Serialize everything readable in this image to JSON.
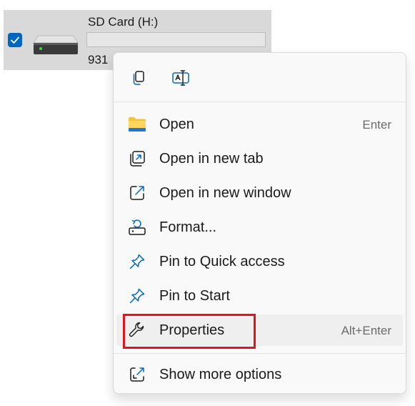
{
  "drive": {
    "name": "SD Card (H:)",
    "size_text": "931",
    "usage_fraction": 0.0,
    "selected": true
  },
  "quick_actions": [
    {
      "icon": "copy-icon"
    },
    {
      "icon": "rename-icon"
    }
  ],
  "menu": {
    "items": [
      {
        "label": "Open",
        "accelerator": "Enter",
        "icon": "folder-icon"
      },
      {
        "label": "Open in new tab",
        "accelerator": "",
        "icon": "new-tab-icon"
      },
      {
        "label": "Open in new window",
        "accelerator": "",
        "icon": "new-window-icon"
      },
      {
        "label": "Format...",
        "accelerator": "",
        "icon": "format-icon"
      },
      {
        "label": "Pin to Quick access",
        "accelerator": "",
        "icon": "pin-icon"
      },
      {
        "label": "Pin to Start",
        "accelerator": "",
        "icon": "pin-icon"
      },
      {
        "label": "Properties",
        "accelerator": "Alt+Enter",
        "icon": "wrench-icon"
      }
    ],
    "more": {
      "label": "Show more options",
      "icon": "show-more-icon"
    }
  },
  "colors": {
    "accent": "#0067c0",
    "highlight_box": "#e0141e",
    "folder": "#f4c23b"
  }
}
